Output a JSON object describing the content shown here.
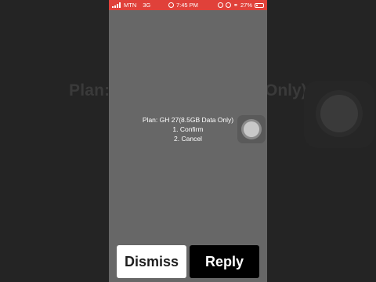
{
  "background": {
    "plan_text_left": "Plan:",
    "plan_text_right": "Only)"
  },
  "status_bar": {
    "carrier": "MTN",
    "network": "3G",
    "time": "7:45 PM",
    "battery_percent": "27%",
    "battery_level": 0.27,
    "color": "#e0413a"
  },
  "ussd": {
    "lines": [
      "Plan: GH 27(8.5GB Data Only)",
      "1. Confirm",
      "2. Cancel"
    ]
  },
  "buttons": {
    "dismiss": "Dismiss",
    "reply": "Reply"
  },
  "icons": [
    "signal-icon",
    "alarm-icon",
    "headphones-icon",
    "battery-icon",
    "assistive-touch-icon"
  ]
}
